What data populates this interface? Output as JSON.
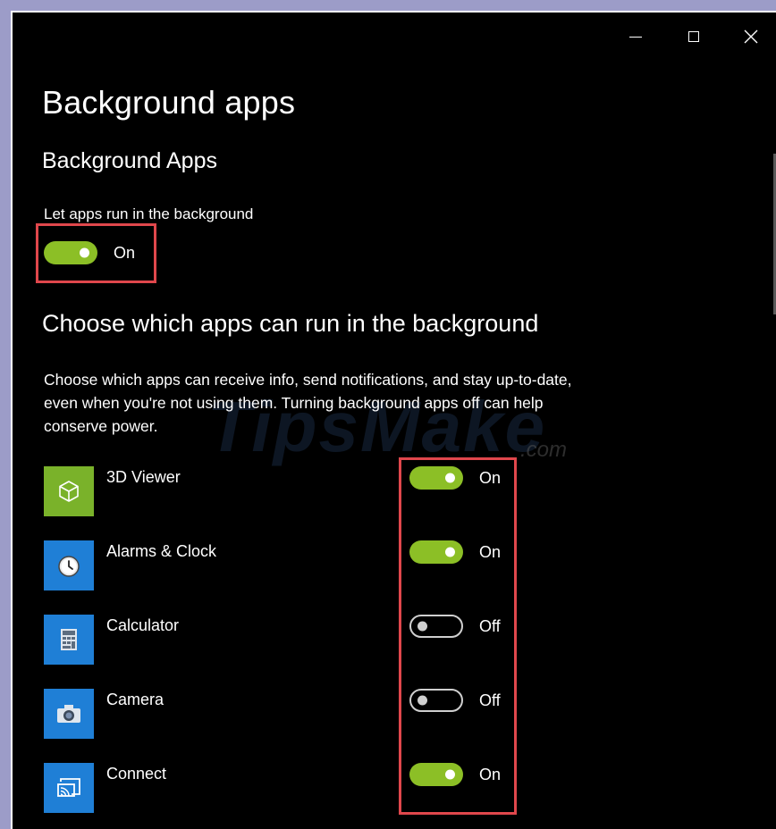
{
  "window": {
    "caption_buttons": [
      "minimize",
      "maximize",
      "close"
    ]
  },
  "page_title": "Background apps",
  "section": {
    "title": "Background Apps",
    "master_label": "Let apps run in the background",
    "master_toggle": {
      "state": "on",
      "label": "On"
    }
  },
  "choose": {
    "title": "Choose which apps can run in the background",
    "description": "Choose which apps can receive info, send notifications, and stay up-to-date, even when you're not using them. Turning background apps off can help conserve power."
  },
  "apps": [
    {
      "name": "3D Viewer",
      "icon": "cube-icon",
      "tile_color": "#7ab22a",
      "state": "on",
      "label": "On"
    },
    {
      "name": "Alarms & Clock",
      "icon": "clock-icon",
      "tile_color": "#1f7fd6",
      "state": "on",
      "label": "On"
    },
    {
      "name": "Calculator",
      "icon": "calculator-icon",
      "tile_color": "#1f7fd6",
      "state": "off",
      "label": "Off"
    },
    {
      "name": "Camera",
      "icon": "camera-icon",
      "tile_color": "#1f7fd6",
      "state": "off",
      "label": "Off"
    },
    {
      "name": "Connect",
      "icon": "cast-icon",
      "tile_color": "#1f7fd6",
      "state": "on",
      "label": "On"
    }
  ],
  "colors": {
    "toggle_on": "#8cbf26",
    "highlight": "#e0474c",
    "background": "#000000"
  },
  "watermark": {
    "text": "TipsMake",
    "suffix": ".com"
  }
}
